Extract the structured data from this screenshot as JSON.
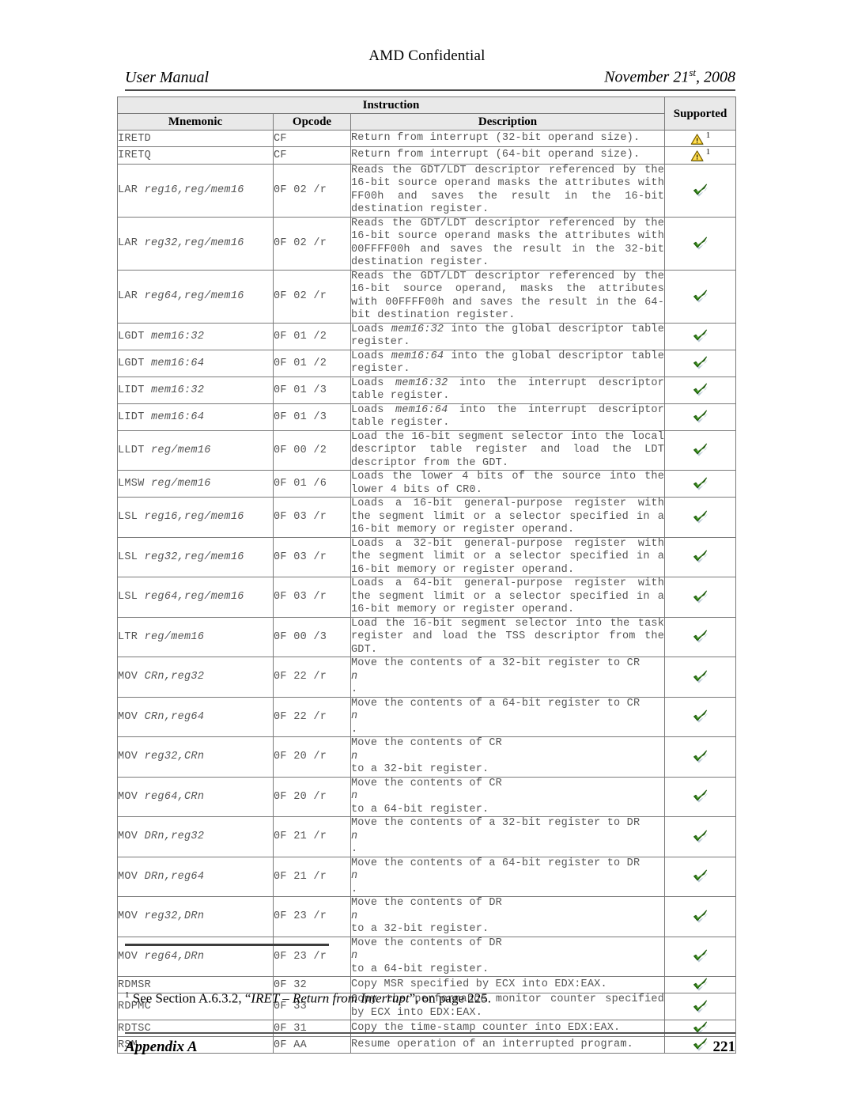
{
  "header": {
    "confidential": "AMD Confidential",
    "doc_type": "User Manual",
    "date_main": "November 21",
    "date_ord": "st",
    "date_year": ", 2008"
  },
  "table": {
    "group_header": "Instruction",
    "supported_header": "Supported",
    "columns": [
      "Mnemonic",
      "Opcode",
      "Description"
    ],
    "icons": {
      "check": "green-check-icon",
      "warning": "warning-triangle-icon",
      "warning_footnote": "1"
    },
    "rows": [
      {
        "mnemonic_base": "IRETD",
        "mnemonic_operands": "",
        "opcode": "CF",
        "description": "Return from interrupt (32-bit operand size).",
        "supported": "warning"
      },
      {
        "mnemonic_base": "IRETQ",
        "mnemonic_operands": "",
        "opcode": "CF",
        "description": "Return from interrupt (64-bit operand size).",
        "supported": "warning"
      },
      {
        "mnemonic_base": "LAR",
        "mnemonic_operands": "reg16,reg/mem16",
        "opcode": "0F 02 /r",
        "description": "Reads the GDT/LDT descriptor referenced by the 16-bit source operand masks the attributes with FF00h and saves the result in the 16-bit destination register.",
        "supported": "check"
      },
      {
        "mnemonic_base": "LAR",
        "mnemonic_operands": "reg32,reg/mem16",
        "opcode": "0F 02 /r",
        "description": "Reads the GDT/LDT descriptor referenced by the 16-bit source operand masks the attributes with 00FFFF00h and saves the result in the 32-bit destination register.",
        "supported": "check"
      },
      {
        "mnemonic_base": "LAR",
        "mnemonic_operands": "reg64,reg/mem16",
        "opcode": "0F 02 /r",
        "description": "Reads the GDT/LDT descriptor referenced by the 16-bit source operand, masks the attributes with 00FFFF00h and saves the result in the 64-bit destination register.",
        "supported": "check"
      },
      {
        "mnemonic_base": "LGDT",
        "mnemonic_operands": "mem16:32",
        "opcode": "0F 01 /2",
        "description": "Loads mem16:32 into the global descriptor table register.",
        "desc_italic": "mem16:32",
        "supported": "check"
      },
      {
        "mnemonic_base": "LGDT",
        "mnemonic_operands": "mem16:64",
        "opcode": "0F 01 /2",
        "description": "Loads mem16:64 into the global descriptor table register.",
        "desc_italic": "mem16:64",
        "supported": "check"
      },
      {
        "mnemonic_base": "LIDT",
        "mnemonic_operands": "mem16:32",
        "opcode": "0F 01 /3",
        "description": "Loads mem16:32 into the interrupt descriptor table register.",
        "desc_italic": "mem16:32",
        "supported": "check"
      },
      {
        "mnemonic_base": "LIDT",
        "mnemonic_operands": "mem16:64",
        "opcode": "0F 01 /3",
        "description": "Loads mem16:64 into the interrupt descriptor table register.",
        "desc_italic": "mem16:64",
        "supported": "check"
      },
      {
        "mnemonic_base": "LLDT",
        "mnemonic_operands": "reg/mem16",
        "opcode": "0F 00 /2",
        "description": "Load the 16-bit segment selector into the local descriptor table register and load the LDT descriptor from the GDT.",
        "supported": "check"
      },
      {
        "mnemonic_base": "LMSW",
        "mnemonic_operands": "reg/mem16",
        "opcode": "0F 01 /6",
        "description": "Loads the lower 4 bits of the source into the lower 4 bits of CR0.",
        "supported": "check"
      },
      {
        "mnemonic_base": "LSL",
        "mnemonic_operands": "reg16,reg/mem16",
        "opcode": "0F 03 /r",
        "description": "Loads a 16-bit general-purpose register with the segment limit or a selector specified in a 16-bit memory or register operand.",
        "supported": "check"
      },
      {
        "mnemonic_base": "LSL",
        "mnemonic_operands": "reg32,reg/mem16",
        "opcode": "0F 03 /r",
        "description": "Loads a 32-bit general-purpose register with the segment limit or a selector specified in a 16-bit memory or register operand.",
        "supported": "check"
      },
      {
        "mnemonic_base": "LSL",
        "mnemonic_operands": "reg64,reg/mem16",
        "opcode": "0F 03 /r",
        "description": "Loads a 64-bit general-purpose register with the segment limit or a selector specified in a 16-bit memory or register operand.",
        "supported": "check"
      },
      {
        "mnemonic_base": "LTR",
        "mnemonic_operands": "reg/mem16",
        "opcode": "0F 00 /3",
        "description": "Load the 16-bit segment selector into the task register and load the TSS descriptor from the GDT.",
        "supported": "check"
      },
      {
        "mnemonic_base": "MOV",
        "mnemonic_operands": "CRn,reg32",
        "opcode": "0F 22 /r",
        "description": "Move the contents of a 32-bit register to CRn.",
        "supported": "check"
      },
      {
        "mnemonic_base": "MOV",
        "mnemonic_operands": "CRn,reg64",
        "opcode": "0F 22 /r",
        "description": "Move the contents of a 64-bit register to CRn.",
        "supported": "check"
      },
      {
        "mnemonic_base": "MOV",
        "mnemonic_operands": "reg32,CRn",
        "opcode": "0F 20 /r",
        "description": "Move the contents of CRn to a 32-bit register.",
        "supported": "check"
      },
      {
        "mnemonic_base": "MOV",
        "mnemonic_operands": "reg64,CRn",
        "opcode": "0F 20 /r",
        "description": "Move the contents of CRn to a 64-bit register.",
        "supported": "check"
      },
      {
        "mnemonic_base": "MOV",
        "mnemonic_operands": "DRn,reg32",
        "opcode": "0F 21 /r",
        "description": "Move the contents of a 32-bit register to DRn.",
        "supported": "check"
      },
      {
        "mnemonic_base": "MOV",
        "mnemonic_operands": "DRn,reg64",
        "opcode": "0F 21 /r",
        "description": "Move the contents of a 64-bit register to DRn.",
        "supported": "check"
      },
      {
        "mnemonic_base": "MOV",
        "mnemonic_operands": "reg32,DRn",
        "opcode": "0F 23 /r",
        "description": "Move the contents of DRn to a 32-bit register.",
        "supported": "check"
      },
      {
        "mnemonic_base": "MOV",
        "mnemonic_operands": "reg64,DRn",
        "opcode": "0F 23 /r",
        "description": "Move the contents of DRn to a 64-bit register.",
        "supported": "check"
      },
      {
        "mnemonic_base": "RDMSR",
        "mnemonic_operands": "",
        "opcode": "0F 32",
        "description": "Copy MSR specified by ECX into EDX:EAX.",
        "supported": "check"
      },
      {
        "mnemonic_base": "RDPMC",
        "mnemonic_operands": "",
        "opcode": "0F 33",
        "description": "Copy the performance monitor counter specified by ECX into EDX:EAX.",
        "supported": "check"
      },
      {
        "mnemonic_base": "RDTSC",
        "mnemonic_operands": "",
        "opcode": "0F 31",
        "description": "Copy the time-stamp counter into EDX:EAX.",
        "supported": "check"
      },
      {
        "mnemonic_base": "RSM",
        "mnemonic_operands": "",
        "opcode": "0F AA",
        "description": "Resume operation of an interrupted program.",
        "supported": "check"
      }
    ]
  },
  "footnote": {
    "marker": "1",
    "prefix": "See Section A.6.3.2, “",
    "italic": "IRET – Return from Interrupt",
    "suffix": "”, on page 225."
  },
  "footer": {
    "left": "Appendix A",
    "page": "221"
  },
  "colors": {
    "check_green": "#3f8f1e",
    "warning_yellow": "#ffd42a",
    "text_gray": "#555555",
    "rule": "#4a4a4a",
    "header_bg": "#e9e9e9"
  }
}
